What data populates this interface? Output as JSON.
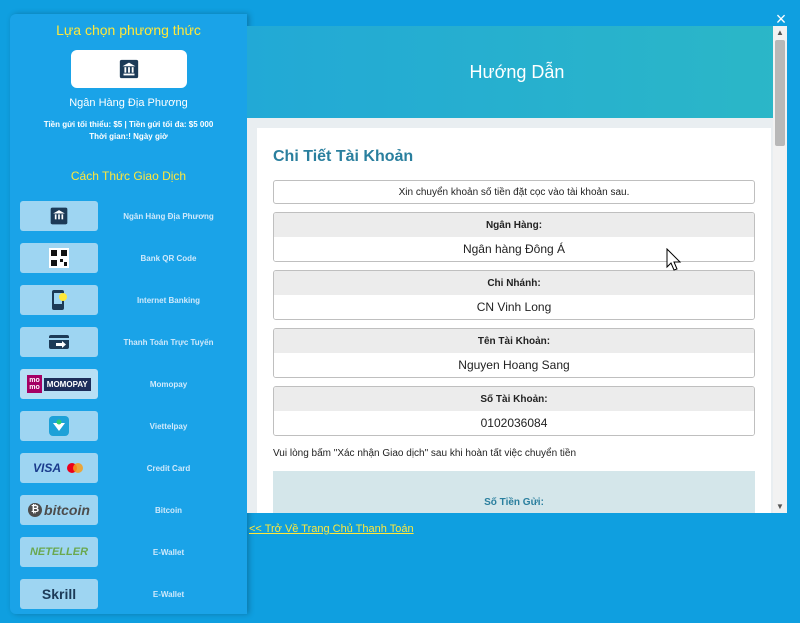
{
  "sidebar": {
    "heading": "Lựa chọn phương thức",
    "selected_method": {
      "name": "Ngân Hàng Địa Phương",
      "limits": "Tiền gửi tối thiểu: $5 | Tiền gửi tối đa: $5 000",
      "time": "Thời gian:! Ngày giờ",
      "icon": "bank-icon"
    },
    "tx_heading": "Cách Thức Giao Dịch",
    "methods": [
      {
        "label": "Ngân Hàng Địa Phương",
        "logo": "bank-icon"
      },
      {
        "label": "Bank QR Code",
        "logo": "qr-icon"
      },
      {
        "label": "Internet Banking",
        "logo": "phone-icon"
      },
      {
        "label": "Thanh Toán Trực Tuyến",
        "logo": "card-arrow-icon"
      },
      {
        "label": "Momopay",
        "logo_text": "MOMOPAY"
      },
      {
        "label": "Viettelpay",
        "logo": "viettel-icon"
      },
      {
        "label": "Credit Card",
        "logo_text": "VISA"
      },
      {
        "label": "Bitcoin",
        "logo_text": "bitcoin"
      },
      {
        "label": "E-Wallet",
        "logo_text": "NETELLER"
      },
      {
        "label": "E-Wallet",
        "logo_text": "Skrill"
      }
    ]
  },
  "main": {
    "header_title": "Hướng Dẫn",
    "card_title": "Chi Tiết Tài Khoản",
    "intro": "Xin chuyển khoản số tiền đặt cọc vào tài khoản sau.",
    "fields": [
      {
        "label": "Ngân Hàng:",
        "value": "Ngân hàng Đông Á"
      },
      {
        "label": "Chi Nhánh:",
        "value": "CN Vinh Long"
      },
      {
        "label": "Tên Tài Khoản:",
        "value": "Nguyen Hoang Sang"
      },
      {
        "label": "Số Tài Khoản:",
        "value": "0102036084"
      }
    ],
    "note": "Vui lòng bấm \"Xác nhận Giao dịch\" sau khi hoàn tất việc chuyển tiền",
    "amount_label": "Số Tiền Gửi:"
  },
  "back_link": "<< Trở Về Trang Chủ Thanh Toán",
  "close_icon": "×",
  "colors": {
    "modal_bg": "#0f9fe0",
    "accent_yellow": "#ffe83a",
    "title_teal": "#2a7f9e"
  }
}
